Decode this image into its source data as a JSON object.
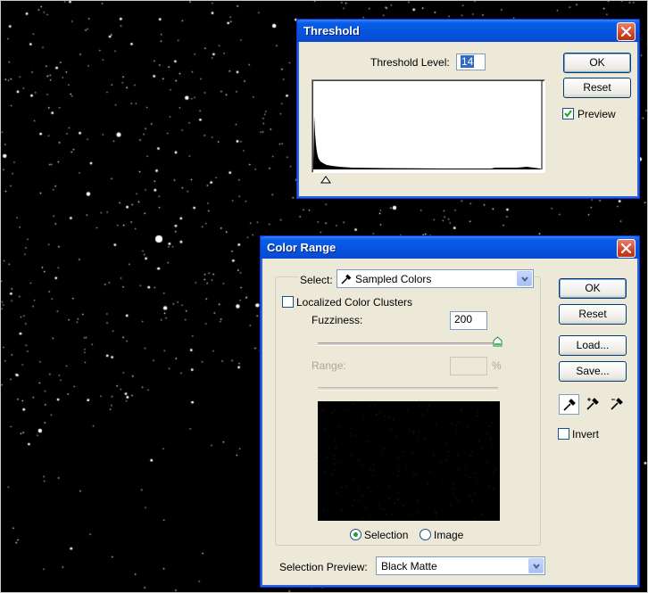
{
  "threshold": {
    "title": "Threshold",
    "level_label": "Threshold Level:",
    "level_value": "14",
    "ok_label": "OK",
    "reset_label": "Reset",
    "preview_label": "Preview",
    "preview_checked": true
  },
  "color_range": {
    "title": "Color Range",
    "select_label": "Select:",
    "select_value": "Sampled Colors",
    "localized_label": "Localized Color Clusters",
    "localized_checked": false,
    "fuzziness_label": "Fuzziness:",
    "fuzziness_value": "200",
    "range_label": "Range:",
    "range_value": "",
    "range_unit": "%",
    "ok_label": "OK",
    "reset_label": "Reset",
    "load_label": "Load...",
    "save_label": "Save...",
    "invert_label": "Invert",
    "invert_checked": false,
    "selection_radio_label": "Selection",
    "image_radio_label": "Image",
    "selected_view": "Selection",
    "preview_label": "Selection Preview:",
    "preview_value": "Black Matte"
  },
  "icons": {
    "close": "close-icon",
    "eyedropper": "eyedropper-icon",
    "eyedropper_plus": "eyedropper-plus-icon",
    "eyedropper_minus": "eyedropper-minus-icon",
    "dropdown": "chevron-down-icon"
  },
  "colors": {
    "titlebar": "#0a5de8",
    "dialog_bg": "#ece9d8",
    "close_button": "#d2432a",
    "check_green": "#21a121"
  }
}
